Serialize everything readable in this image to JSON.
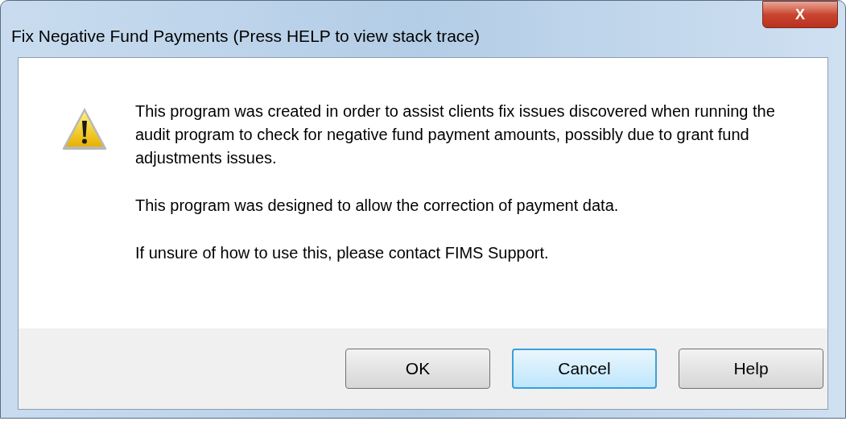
{
  "window": {
    "title": "Fix Negative Fund Payments (Press HELP to view stack trace)",
    "close": "X"
  },
  "message": {
    "kind": "warning",
    "paragraphs": [
      "This program was created in order to assist clients fix issues discovered when running the audit program to check for negative fund payment amounts, possibly due to grant fund adjustments issues.",
      "This program was designed to allow the correction of payment data.",
      "If unsure of how to use this, please contact FIMS Support."
    ]
  },
  "buttons": [
    {
      "label": "OK",
      "focused": false
    },
    {
      "label": "Cancel",
      "focused": true
    },
    {
      "label": "Help",
      "focused": false
    }
  ]
}
